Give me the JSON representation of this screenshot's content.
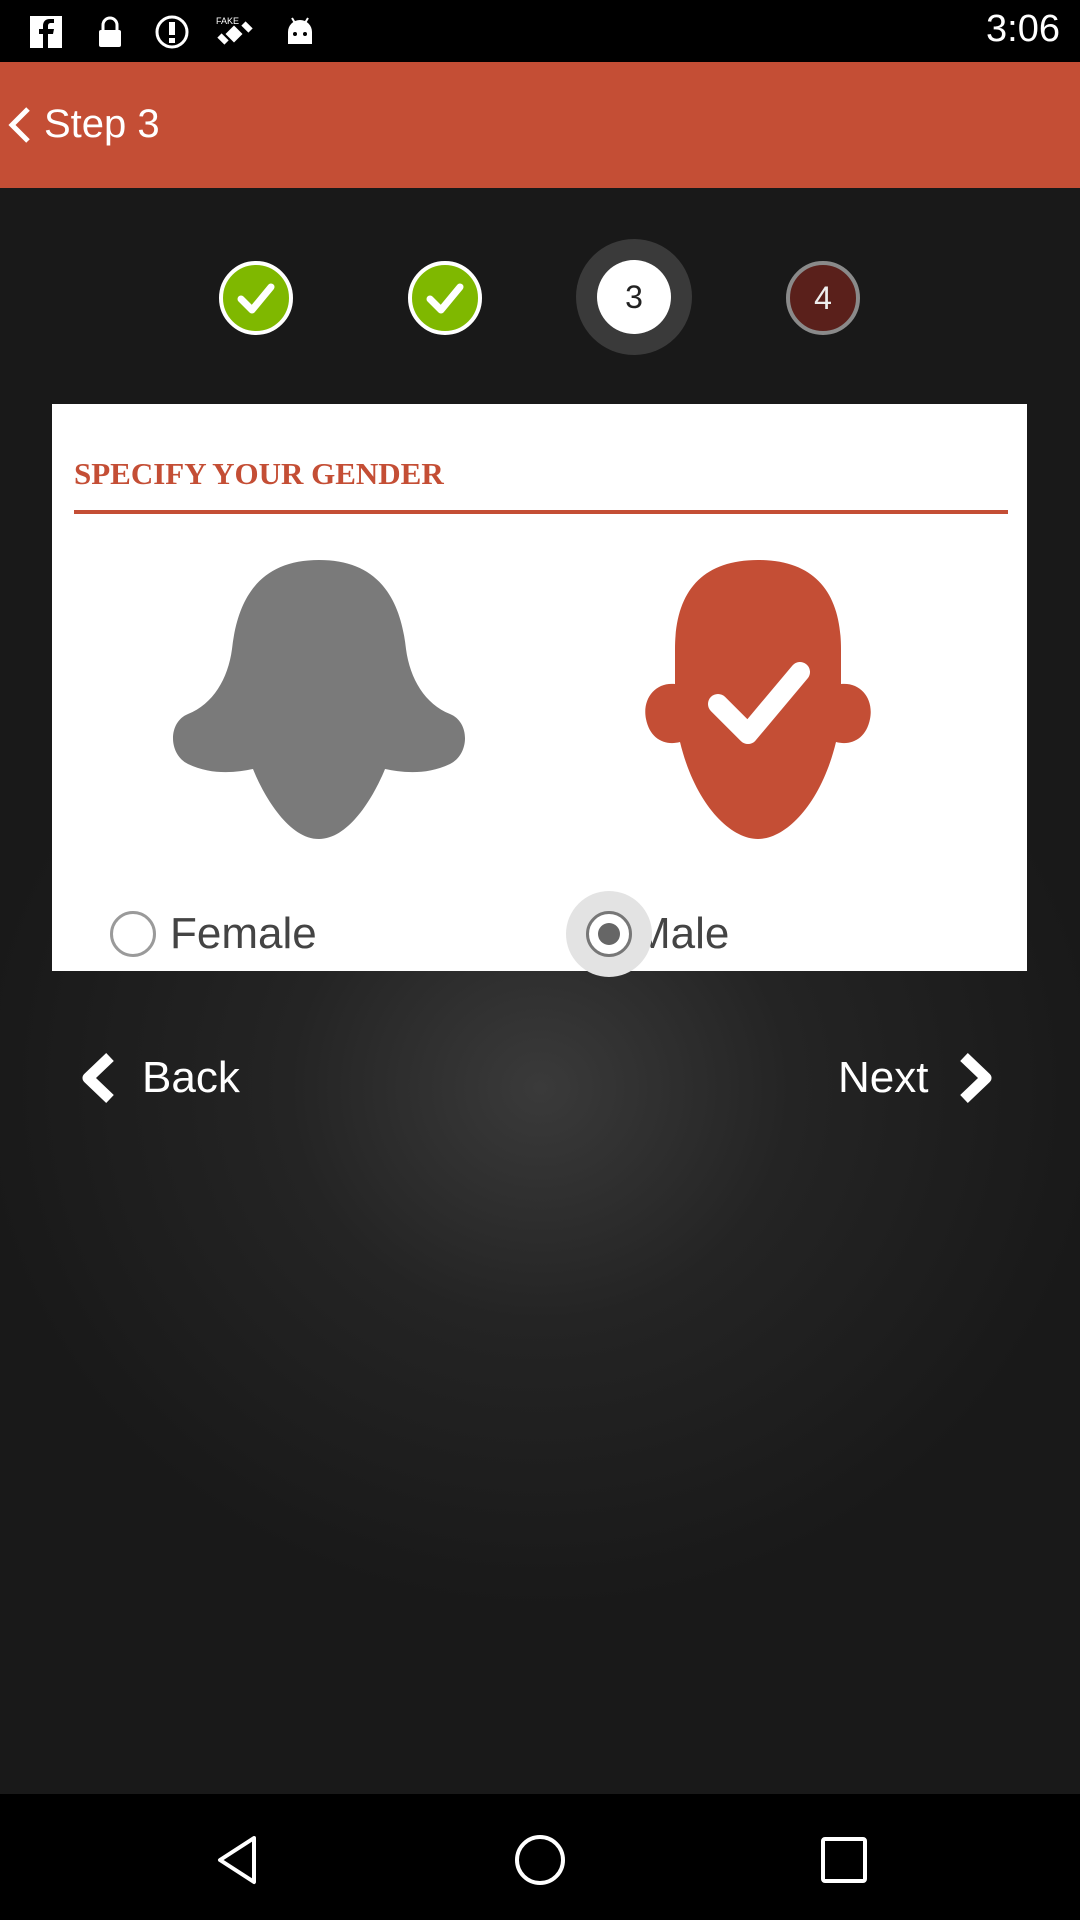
{
  "status_bar": {
    "time": "3:06",
    "icons": [
      "facebook-icon",
      "lock-icon",
      "alert-icon",
      "satellite-icon",
      "android-icon"
    ]
  },
  "app_bar": {
    "title": "Step 3",
    "back_icon": "chevron-left-icon",
    "background": "#c44e35"
  },
  "steps": [
    {
      "state": "done",
      "icon": "check-icon"
    },
    {
      "state": "done",
      "icon": "check-icon"
    },
    {
      "state": "current",
      "label": "3"
    },
    {
      "state": "future",
      "label": "4"
    }
  ],
  "card": {
    "title": "SPECIFY YOUR GENDER",
    "options": [
      {
        "label": "Female",
        "selected": false,
        "icon": "female-silhouette-icon",
        "color": "#7a7a7a"
      },
      {
        "label": "Male",
        "selected": true,
        "icon": "male-silhouette-check-icon",
        "color": "#c44e35"
      }
    ]
  },
  "navigation": {
    "back_label": "Back",
    "next_label": "Next"
  },
  "system_nav": {
    "icons": [
      "back-triangle-icon",
      "home-circle-icon",
      "recents-square-icon"
    ]
  },
  "colors": {
    "accent": "#c44e35",
    "step_done": "#7fb800",
    "step_future": "#5a201b"
  }
}
